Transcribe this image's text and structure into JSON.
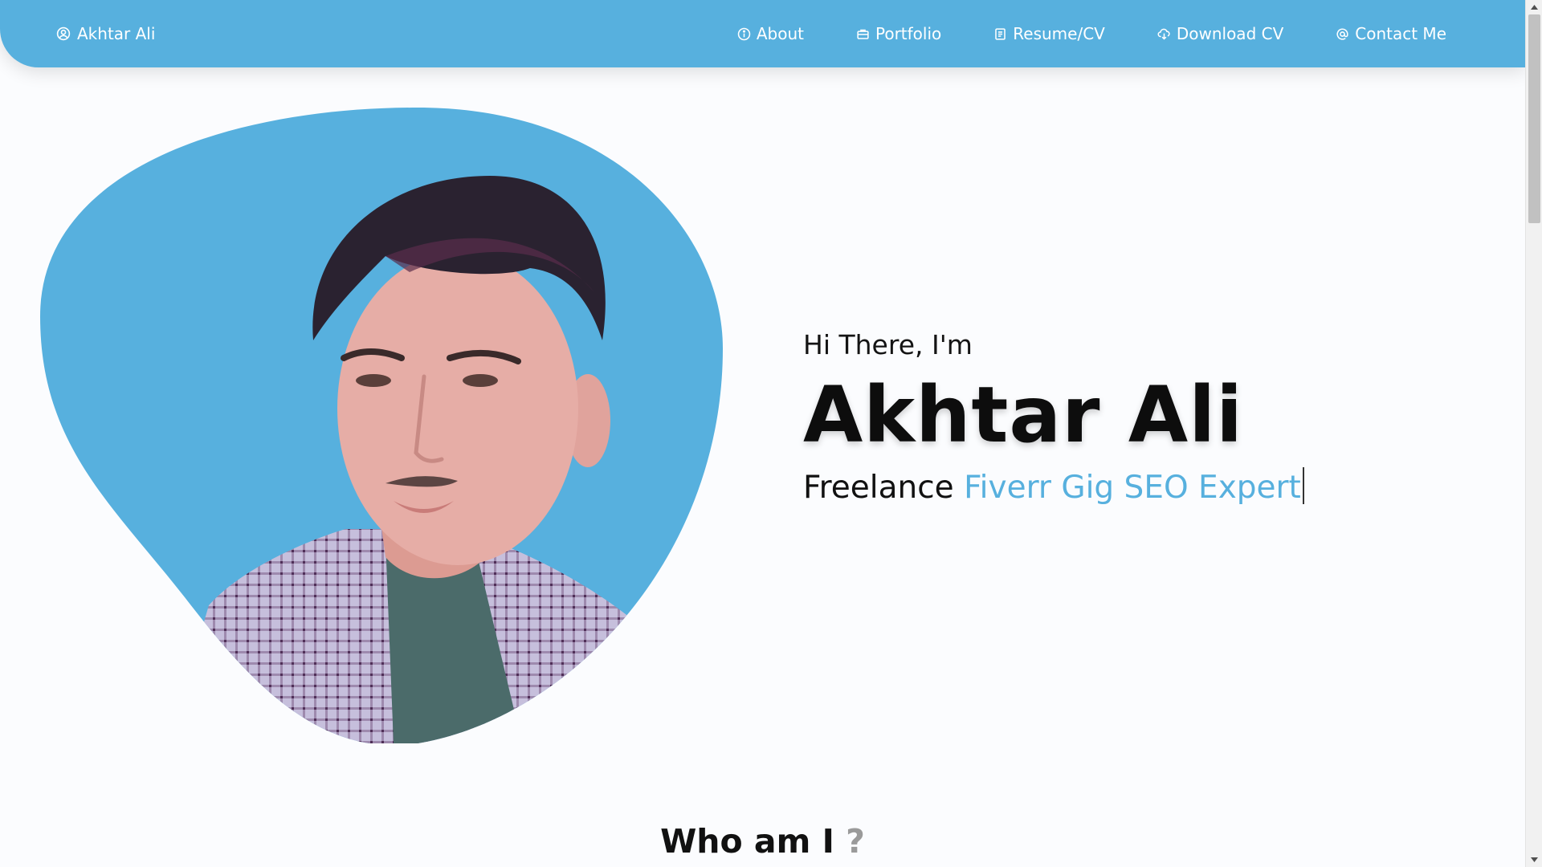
{
  "nav": {
    "brand": "Akhtar Ali",
    "items": [
      {
        "label": "About",
        "icon": "info-icon"
      },
      {
        "label": "Portfolio",
        "icon": "briefcase-icon"
      },
      {
        "label": "Resume/CV",
        "icon": "document-icon"
      },
      {
        "label": "Download CV",
        "icon": "cloud-download-icon"
      },
      {
        "label": "Contact Me",
        "icon": "at-icon"
      }
    ]
  },
  "hero": {
    "greeting": "Hi There, I'm",
    "name": "Akhtar Ali",
    "tagline_prefix": "Freelance",
    "tagline_role": "Fiverr Gig SEO Expert"
  },
  "about": {
    "title": "Who am I",
    "title_suffix": "?"
  },
  "colors": {
    "accent": "#57b0de",
    "background": "#fbfcfe",
    "text": "#111111"
  }
}
